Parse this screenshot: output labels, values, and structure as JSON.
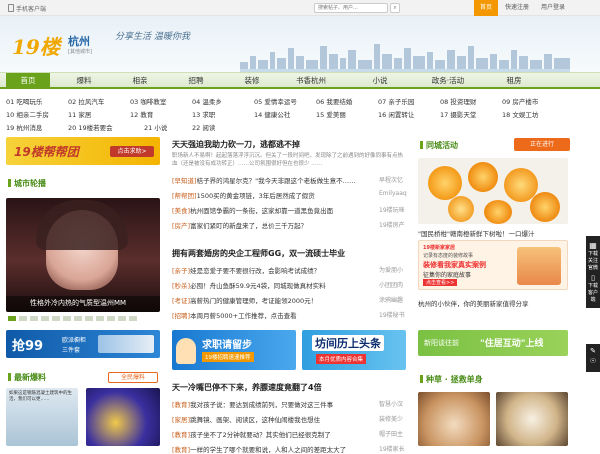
{
  "topbar": {
    "app_label": "手机客户端",
    "search_placeholder": "搜索帖子、用户...",
    "links": [
      {
        "label": "首页",
        "active": true
      },
      {
        "label": "快速注册",
        "active": false
      },
      {
        "label": "用户登录",
        "active": false
      }
    ]
  },
  "header": {
    "logo": "19楼",
    "city": "杭州",
    "city_sub": "[其他城市]",
    "slogan": "分享生活 温暖你我"
  },
  "nav": {
    "items": [
      "首页",
      "爆料",
      "相亲",
      "招聘",
      "装修",
      "书香杭州",
      "小说",
      "政务·活动",
      "租房"
    ]
  },
  "subnav": {
    "rows": [
      [
        "01 吃喝玩乐",
        "02 拉风汽车",
        "03 咖啡教室",
        "04 温柔乡",
        "05 爱情幸运号",
        "06 我要结婚",
        "07 亲子乐园",
        "08 投资理财",
        "09 房产楼市"
      ],
      [
        "10 相亲二手房",
        "11 家居",
        "12 教育",
        "13 求职",
        "14 健康公社",
        "15 爱美丽",
        "16 闲置转让",
        "17 摄影天堂",
        "18 文娱工坊"
      ],
      [
        "19 杭州消息",
        "20 19楼若要会",
        "21 小说",
        "22 阅读"
      ]
    ]
  },
  "left": {
    "banner1": {
      "title": "19楼帮帮团",
      "button": "点击求助>"
    },
    "carousel_title": "城市轮播",
    "carousel_caption": "性格外冷内热的气质型温州MM",
    "banner2": {
      "big": "抢99",
      "small1": "欧派橱柜",
      "small2": "三件套"
    },
    "news_title": "最新爆料",
    "news_button": "全民爆料",
    "news_caption": "如果这是钢筋混凝土建筑中的生活，我们可以更……"
  },
  "center": {
    "headline1": "天天强迫我助力砍一刀，逃都逃不掉",
    "summary1": "职场新人不易啊！起起落落浮浮沉沉。但关了一段时间吧，发现除了之前遇到的好像同事有点热血（还是被没有成功转正）……公司氛围很好但在也很少 ……",
    "list1": [
      {
        "tag": "[早知道]",
        "text": "桔子界的鸿星尔克？\"我今天非跟这个老板做生意不……",
        "src": "早程次忆"
      },
      {
        "tag": "[帮帮团]",
        "text": "1500买的黄金项链，3年后居然成了假货",
        "src": "Emilyaaq"
      },
      {
        "tag": "[美食]",
        "text": "杭州面馆争霸的一条街，这家却靠一道黑鱼竟出面",
        "src": "19楼玩咪"
      },
      {
        "tag": "[房产]",
        "text": "富家们紧盯的新盘来了，总价三千万起？",
        "src": "19楼房产"
      }
    ],
    "headline2": "拥有两套婚房的央企工程师GG，双一流硕士毕业",
    "list2": [
      {
        "tag": "[亲子]",
        "text": "娃是恋爱子要不要很行改，会影响考试成绩？",
        "src": "为爱朋小"
      },
      {
        "tag": "[秒杀]",
        "text": "必囤！舟山鱼酥59.9元4袋，同城现做真材实料",
        "src": "小团团肉"
      },
      {
        "tag": "[考证]",
        "text": "高薪热门的健康管理师，考证能领2000元！",
        "src": "涂鸦幽趣"
      },
      {
        "tag": "[招聘]",
        "text": "本周月薪5000+工作推荐，点击查看",
        "src": "19楼秘书"
      }
    ],
    "banner_a": {
      "title": "求职请留步",
      "sub": "19楼招聘速速推荐"
    },
    "banner_b": {
      "title": "坊间历上头条",
      "sub": "本月优质内容合集"
    },
    "headline3": "天一冷嘴巴停不下来，养膘速度竟翻了4倍",
    "list3": [
      {
        "tag": "[教育]",
        "text": "我对孩子说：要达到成绩前列，只要做对这三件事",
        "src": "智慧小汉"
      },
      {
        "tag": "[家居]",
        "text": "跳舞镜、画架、阅读区，这种仙闹楼我也想住",
        "src": "装修美少"
      },
      {
        "tag": "[教育]",
        "text": "孩子坐不了2分钟就要动？其实他们已经很克制了",
        "src": "帽子田主"
      },
      {
        "tag": "[教育]",
        "text": "一样的学生了哪个就要和说，人和人之间的差距太大了",
        "src": "19楼家长"
      }
    ]
  },
  "right": {
    "activity_title": "同城活动",
    "activity_button": "正在进行",
    "caption1": "\"国民桥柑\"赣南橙新鲜下树啦！一口爆汁",
    "ad_brand": "19楼新家家居",
    "ad_line1": "记录有态度的装修故事",
    "ad_line2": "装修看我家真实案例",
    "ad_line3": "征集你的家庭故事",
    "ad_btn": "点击查看>>",
    "caption2": "杭州的小伙伴，你的美丽新家值得分享",
    "banner_left": "新阳谈往前",
    "banner_right": "\"住居互动\"上线",
    "section_title": "种草 · 拯救单身"
  },
  "side_tab": {
    "line1": "下载",
    "line2": "关注",
    "line3": "官微",
    "line4": "下载",
    "line5": "客户端"
  },
  "colors": {
    "brand_green": "#6aa21c",
    "accent_orange": "#ec6a1a",
    "tag_orange": "#c8601e",
    "logo_gold": "#f0a800"
  }
}
